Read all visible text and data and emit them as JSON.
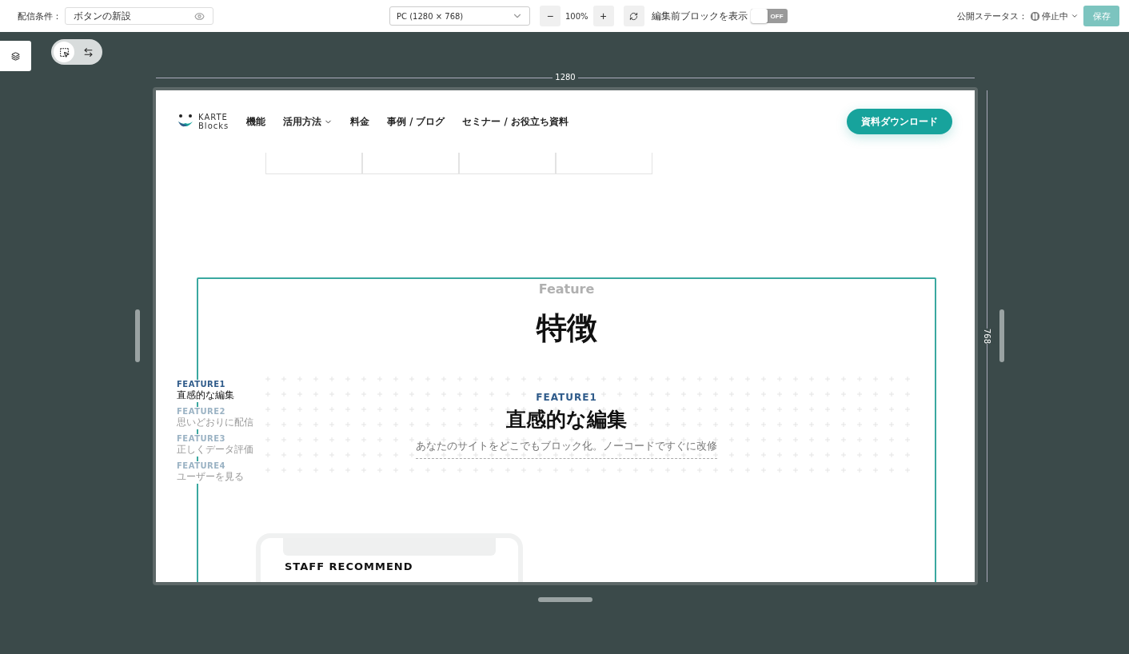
{
  "toolbar": {
    "condition_label": "配信条件：",
    "condition_value": "ボタンの新設",
    "device": "PC (1280 × 768)",
    "zoom": "100%",
    "zoom_out": "−",
    "zoom_in": "+",
    "show_before_label": "編集前ブロックを表示",
    "show_before": {
      "on": false,
      "text": "OFF"
    },
    "status_label": "公開ステータス：",
    "status": "停止中",
    "save": {
      "label": "保存",
      "disabled": true
    }
  },
  "mode_switch": [
    {
      "kind": "select",
      "selected": true
    },
    {
      "kind": "swap",
      "selected": false
    }
  ],
  "canvas": {
    "width_label": "1280",
    "height_label": "768"
  },
  "site": {
    "logo_top": "KARTE",
    "logo_bottom": "Blocks",
    "nav": [
      {
        "label": "機能",
        "dropdown": false
      },
      {
        "label": "活用方法",
        "dropdown": true
      },
      {
        "label": "料金",
        "dropdown": false
      },
      {
        "label": "事例 / ブログ",
        "dropdown": false
      },
      {
        "label": "セミナー / お役立ち資料",
        "dropdown": false
      }
    ],
    "cta": "資料ダウンロード",
    "section_eyebrow": "Feature",
    "section_title": "特徴",
    "feature_nav": [
      {
        "tag": "FEATURE1",
        "title": "直感的な編集",
        "selected": true
      },
      {
        "tag": "FEATURE2",
        "title": "思いどおりに配信",
        "selected": false
      },
      {
        "tag": "FEATURE3",
        "title": "正しくデータ評価",
        "selected": false
      },
      {
        "tag": "FEATURE4",
        "title": "ユーザーを見る",
        "selected": false
      }
    ],
    "feature_tag": "FEATURE1",
    "feature_title": "直感的な編集",
    "feature_text": "あなたのサイトをどこでもブロック化。ノーコードですぐに改修",
    "card_title": "STAFF RECOMMEND"
  }
}
